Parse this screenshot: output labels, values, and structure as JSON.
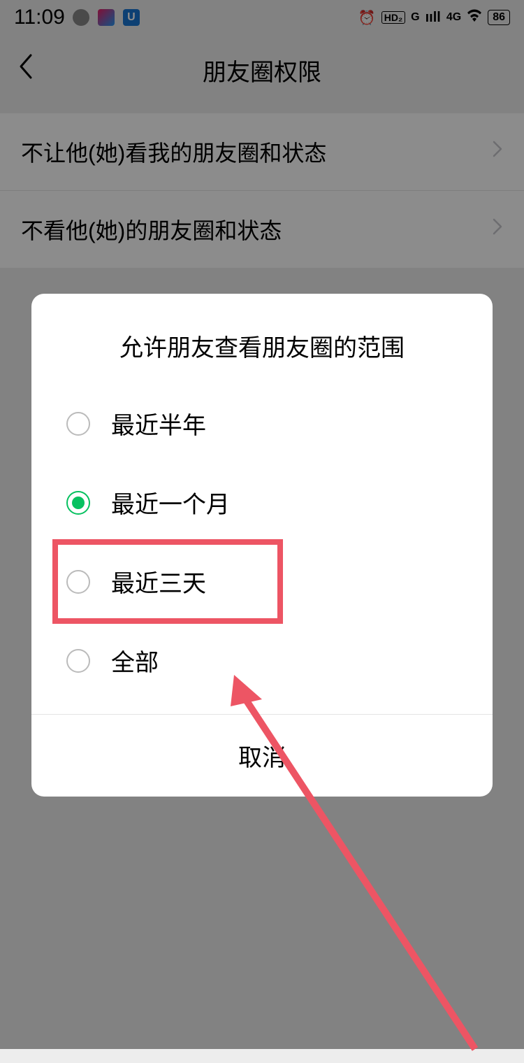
{
  "statusBar": {
    "time": "11:09",
    "hdLabel": "HD₂",
    "signalG": "G",
    "network": "4G",
    "battery": "86"
  },
  "header": {
    "title": "朋友圈权限"
  },
  "settings": {
    "items": [
      {
        "label": "不让他(她)看我的朋友圈和状态"
      },
      {
        "label": "不看他(她)的朋友圈和状态"
      }
    ]
  },
  "dialog": {
    "title": "允许朋友查看朋友圈的范围",
    "options": [
      {
        "label": "最近半年",
        "selected": false,
        "highlighted": false
      },
      {
        "label": "最近一个月",
        "selected": true,
        "highlighted": false
      },
      {
        "label": "最近三天",
        "selected": false,
        "highlighted": true
      },
      {
        "label": "全部",
        "selected": false,
        "highlighted": false
      }
    ],
    "cancel": "取消"
  }
}
